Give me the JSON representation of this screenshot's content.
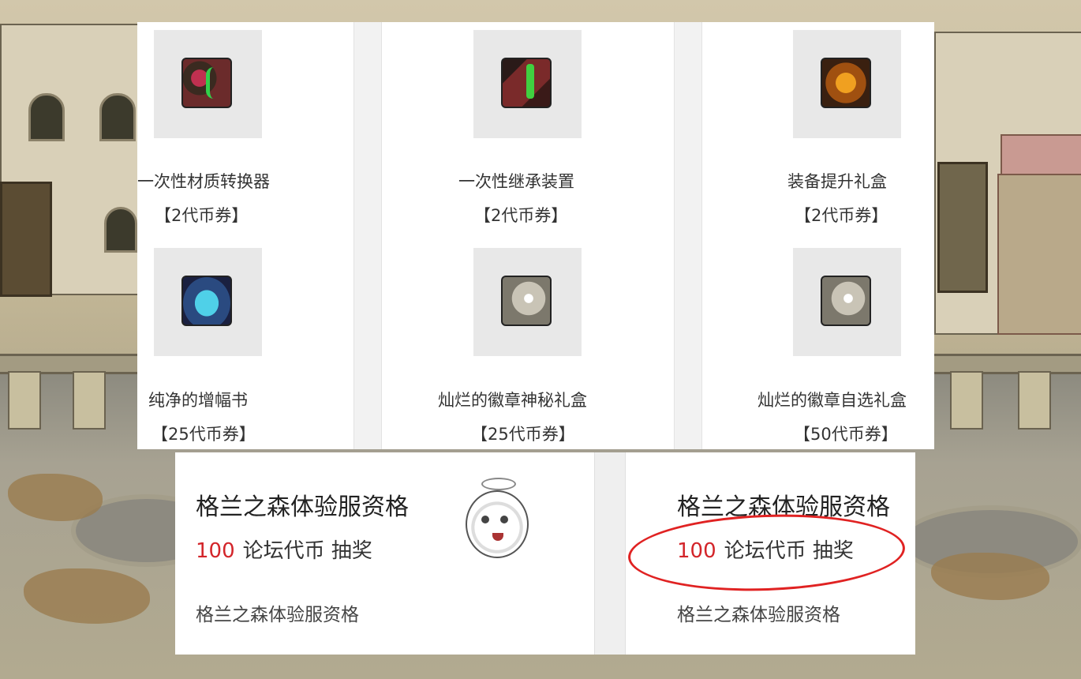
{
  "items": [
    {
      "name": "一次性材质转换器",
      "price": "【2代币券】",
      "icon": "material-converter-icon"
    },
    {
      "name": "一次性继承装置",
      "price": "【2代币券】",
      "icon": "inheritance-device-icon"
    },
    {
      "name": "装备提升礼盒",
      "price": "【2代币券】",
      "icon": "equipment-upgrade-box-icon"
    },
    {
      "name": "纯净的增幅书",
      "price": "【25代币券】",
      "icon": "amplify-book-icon"
    },
    {
      "name": "灿烂的徽章神秘礼盒",
      "price": "【25代币券】",
      "icon": "emblem-mystery-box-icon"
    },
    {
      "name": "灿烂的徽章自选礼盒",
      "price": "【50代币券】",
      "icon": "emblem-select-box-icon"
    }
  ],
  "cards": [
    {
      "title": "格兰之森体验服资格",
      "cost_value": "100",
      "cost_text": "论坛代币 抽奖",
      "footer": "格兰之森体验服资格"
    },
    {
      "title": "格兰之森体验服资格",
      "cost_value": "100",
      "cost_text": "论坛代币 抽奖",
      "footer": "格兰之森体验服资格"
    }
  ],
  "colors": {
    "cost_value": "#d3252a",
    "highlight_circle": "#e02222"
  }
}
